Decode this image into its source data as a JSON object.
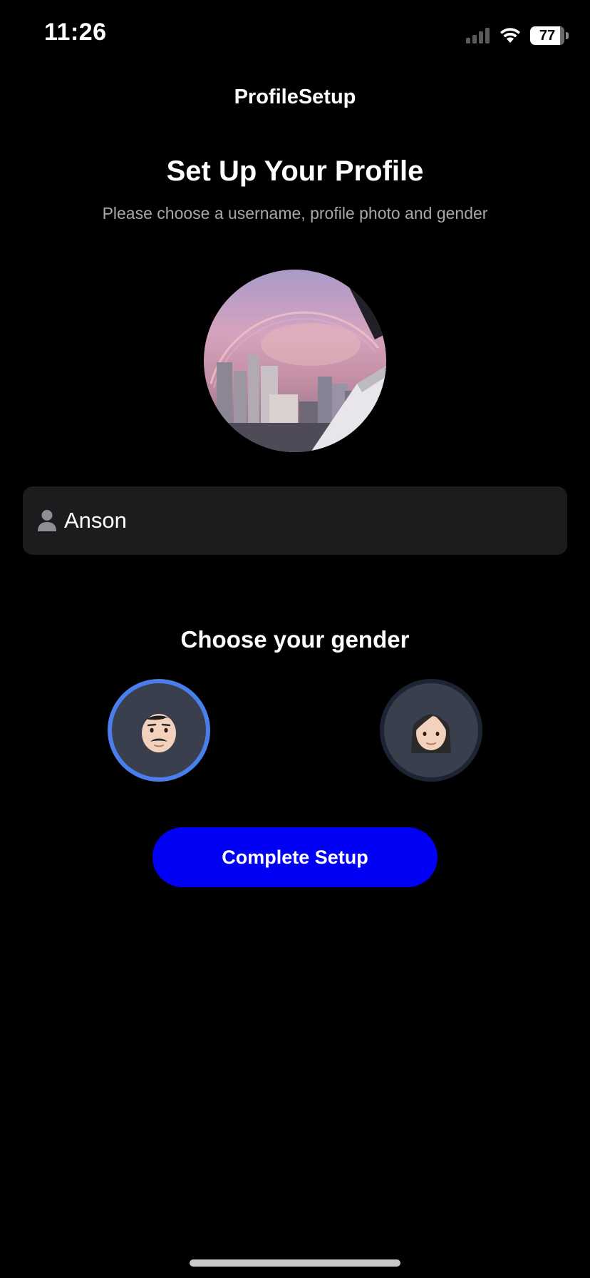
{
  "status_bar": {
    "time": "11:26",
    "battery_level": "77",
    "signal_icon": "cellular-signal-icon",
    "wifi_icon": "wifi-icon"
  },
  "nav": {
    "title": "ProfileSetup"
  },
  "header": {
    "title": "Set Up Your Profile",
    "subtitle": "Please choose a username, profile photo and gender"
  },
  "profile_photo": {
    "icon": "profile-photo-image"
  },
  "username": {
    "value": "Anson",
    "icon": "person-icon"
  },
  "gender": {
    "title": "Choose your gender",
    "options": [
      {
        "id": "male",
        "icon": "man-emoji-icon",
        "selected": true
      },
      {
        "id": "female",
        "icon": "woman-emoji-icon",
        "selected": false
      }
    ]
  },
  "actions": {
    "complete_label": "Complete Setup"
  },
  "colors": {
    "background": "#000000",
    "field_background": "#1c1c1e",
    "primary_button": "#0000f5",
    "selected_ring": "#4a7eeb",
    "unselected_ring": "#1d2433",
    "subtitle_text": "#a7a7ac"
  }
}
